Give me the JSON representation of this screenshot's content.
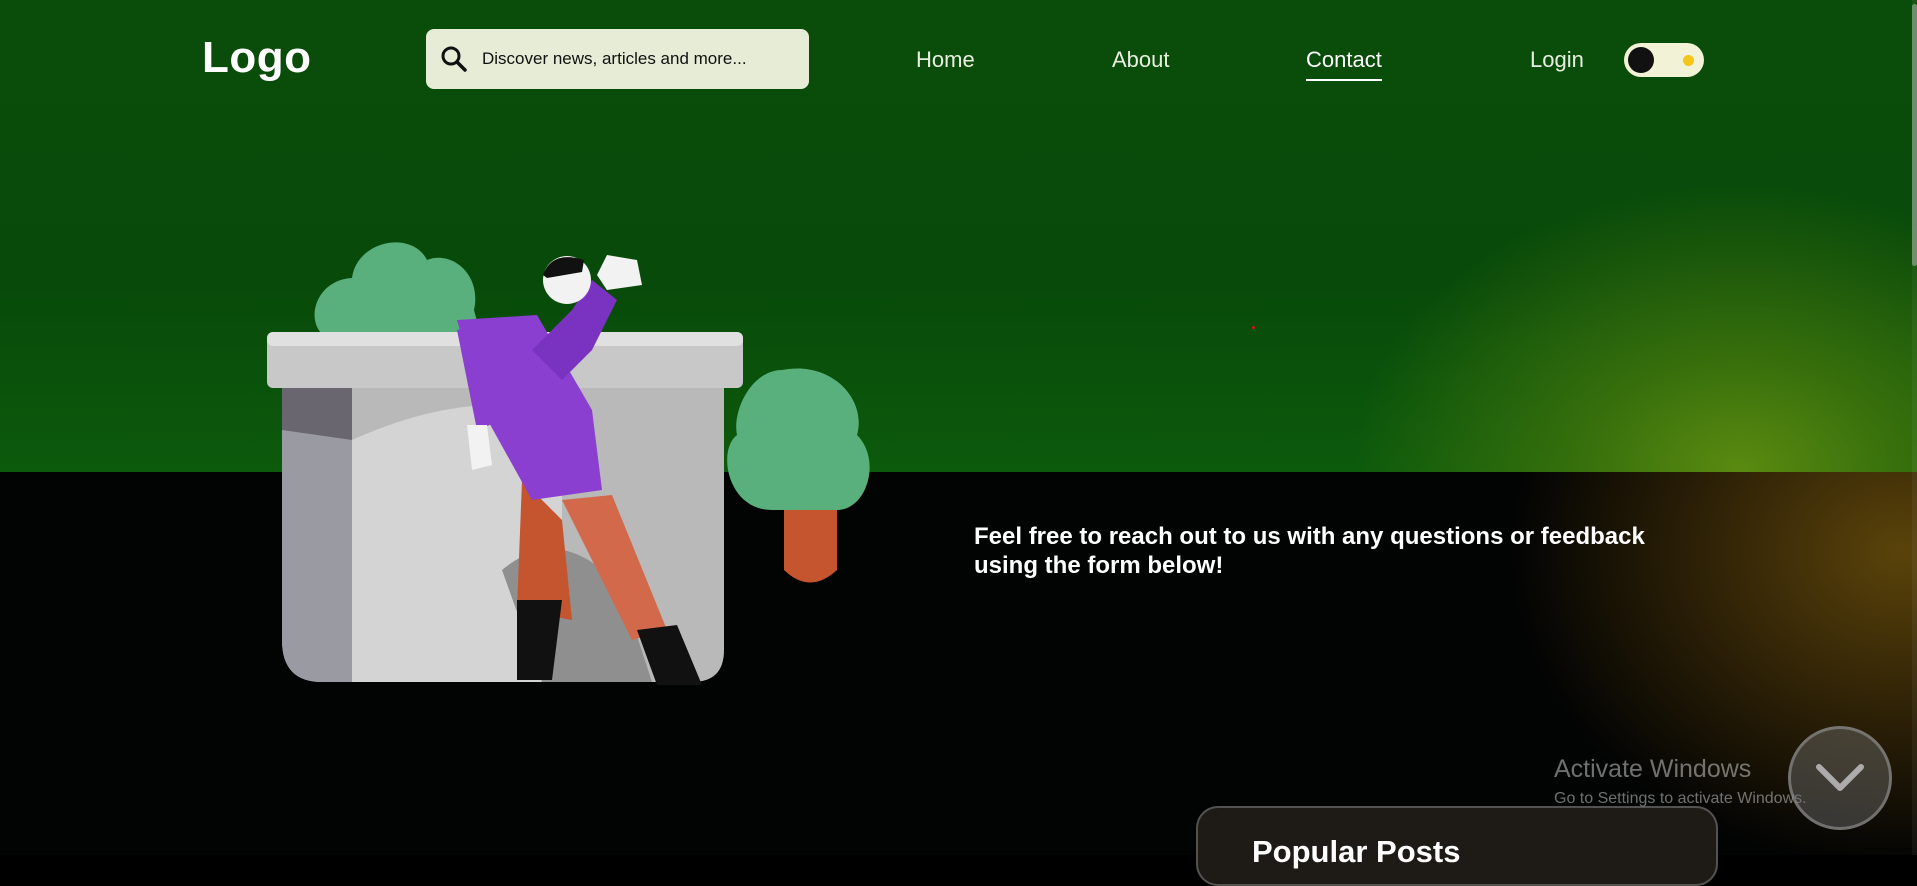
{
  "header": {
    "logo": "Logo",
    "search": {
      "placeholder": "Discover news, articles and more...",
      "icon": "search-icon"
    },
    "nav": [
      {
        "label": "Home",
        "active": false
      },
      {
        "label": "About",
        "active": false
      },
      {
        "label": "Contact",
        "active": true
      },
      {
        "label": "Login",
        "active": false
      }
    ],
    "theme_toggle": {
      "state": "dark",
      "icon": "sun-icon"
    }
  },
  "hero": {
    "message": "Feel free to reach out to us with any questions or feedback using the form below!"
  },
  "popular_posts": {
    "title": "Popular Posts"
  },
  "watermark": {
    "title": "Activate Windows",
    "subtitle": "Go to Settings to activate Windows."
  },
  "colors": {
    "top_band": "#0a4d0a",
    "bottom_band": "#020303",
    "search_bg": "#e6ecd6",
    "toggle_bg": "#f2f3d6",
    "accent_purple": "#8b3fd1",
    "accent_green": "#5ab07c",
    "accent_orange": "#d2694a"
  }
}
